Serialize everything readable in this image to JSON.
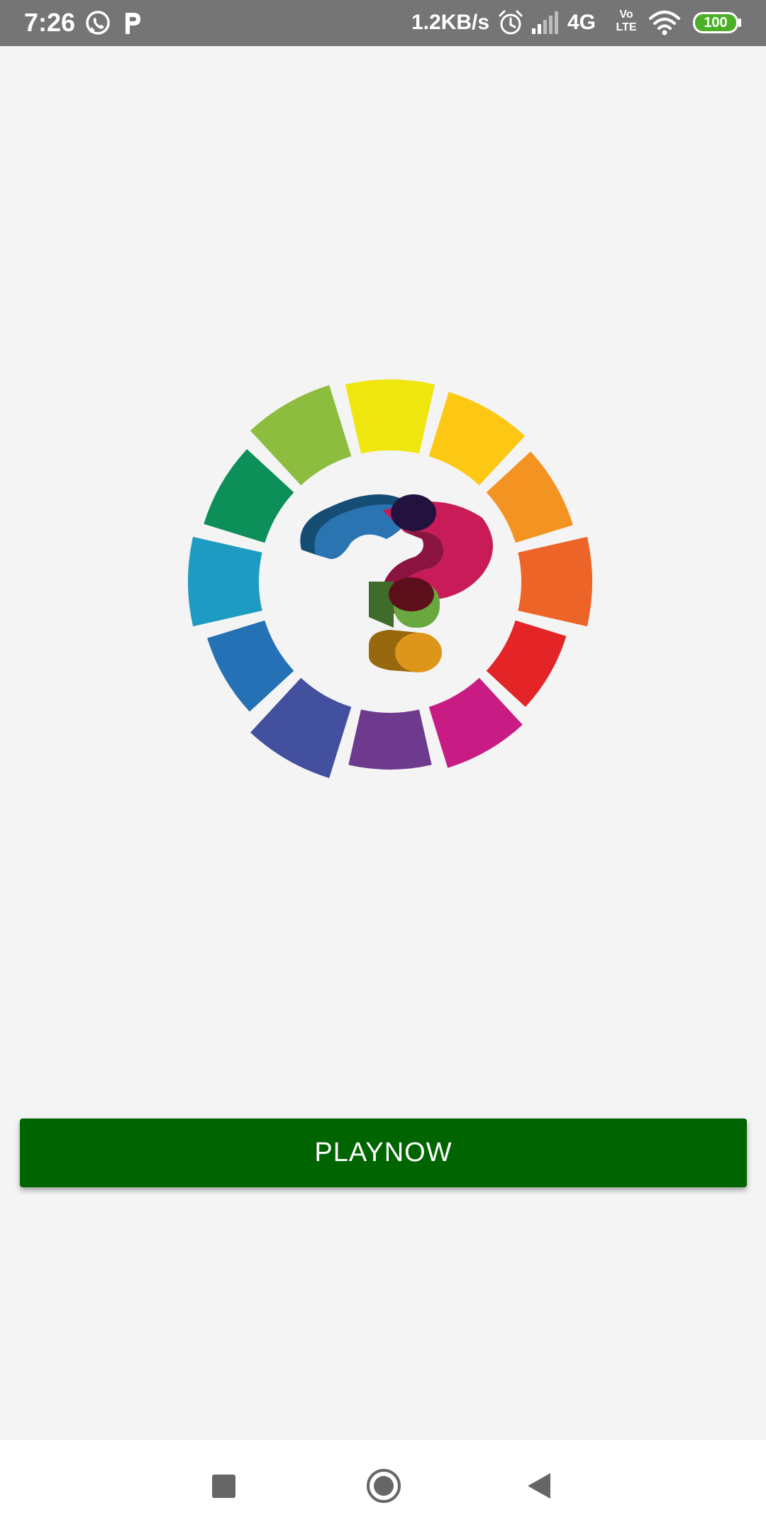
{
  "status_bar": {
    "time": "7:26",
    "net_speed": "1.2KB/s",
    "network": "4G",
    "volte_top": "Vo",
    "volte_bottom": "LTE",
    "battery": "100",
    "icons": [
      "whatsapp-icon",
      "p-icon",
      "alarm-icon",
      "signal-icon",
      "wifi-icon",
      "battery-icon"
    ]
  },
  "logo": {
    "icon": "question-mark-color-wheel",
    "segment_colors": [
      "#f0e60f",
      "#fcc814",
      "#f39422",
      "#ec6427",
      "#e42527",
      "#c81b84",
      "#6e3a8d",
      "#43509e",
      "#2571b5",
      "#1e9bc2",
      "#0c8f58",
      "#8dbd3e"
    ]
  },
  "main": {
    "play_button_label": "PLAYNOW",
    "button_color": "#006400"
  },
  "nav_bar": {
    "icons": [
      "recents-icon",
      "home-icon",
      "back-icon"
    ]
  }
}
